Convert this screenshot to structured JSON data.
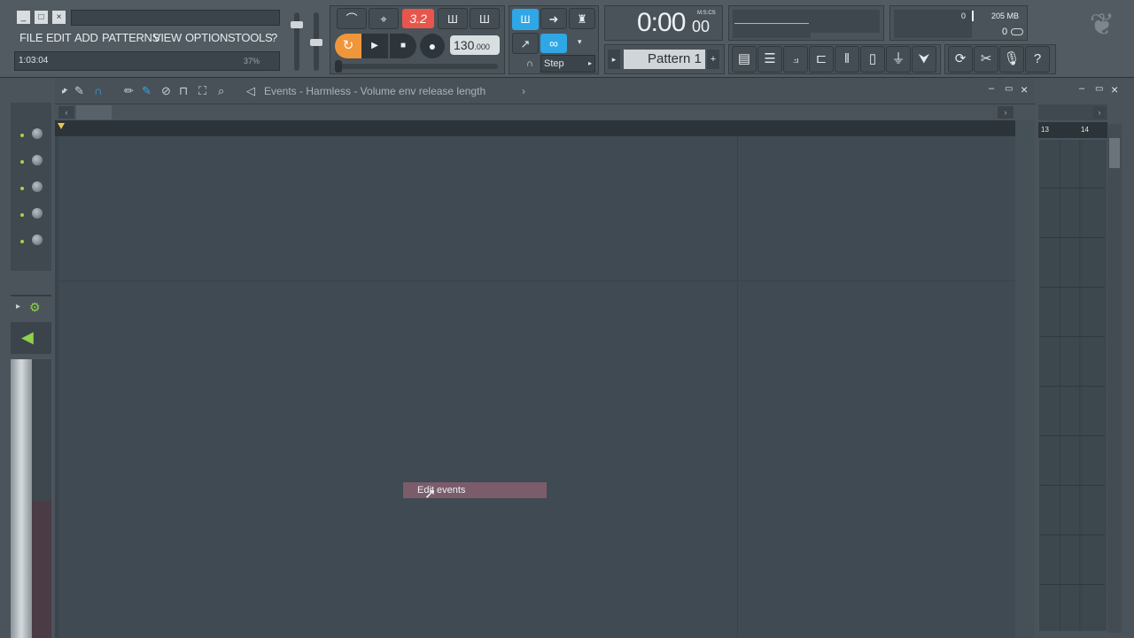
{
  "menu": [
    "FILE",
    "EDIT",
    "ADD",
    "PATTERNS",
    "VIEW",
    "OPTIONS",
    "TOOLS",
    "?"
  ],
  "status": {
    "time": "1:03:04",
    "percent": "37%"
  },
  "transport": {
    "pattern_song": "3.2",
    "tempo": "130",
    "tempo_fraction": ".000"
  },
  "clock": {
    "time": "0:00",
    "small": "00",
    "unit": "M:S:CS"
  },
  "memory": {
    "cpu": "0",
    "mem": "205 MB",
    "poly": "0"
  },
  "snap": "Step",
  "pattern": {
    "label": "Pattern 1",
    "prev": "▸",
    "add": "+"
  },
  "editor": {
    "title": "Events - Harmless - Volume env release length",
    "title_arrow": "›",
    "context_item": "Edit events"
  },
  "right_panel": {
    "col13": "13",
    "col14": "14"
  },
  "colors": {
    "accent_orange": "#f0963a",
    "accent_red": "#e8554d",
    "accent_blue": "#2fa7e6",
    "led_green": "#a6d34a",
    "context_bg": "#7a5c6b"
  },
  "icons": {
    "close": "×",
    "max": "□",
    "min": "_",
    "play": "▶",
    "stop": "■",
    "record": "●",
    "loop": "↻",
    "metronome": "⌖",
    "help": "?"
  }
}
